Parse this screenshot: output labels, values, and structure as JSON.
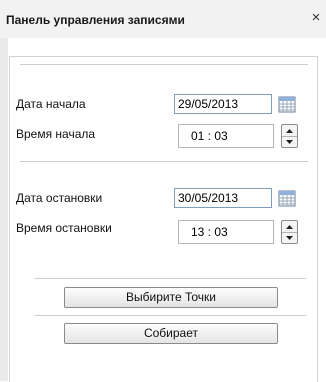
{
  "window": {
    "title": "Панель управления записями",
    "close_label": "×"
  },
  "form": {
    "start_date": {
      "label": "Дата начала",
      "value": "29/05/2013"
    },
    "start_time": {
      "label": "Время начала",
      "value": "01 : 03"
    },
    "stop_date": {
      "label": "Дата остановки",
      "value": "30/05/2013"
    },
    "stop_time": {
      "label": "Время остановки",
      "value": "13 : 03"
    }
  },
  "buttons": {
    "select_points": "Выбирите Точки",
    "collect": "Собирает"
  },
  "icons": {
    "calendar": "calendar-icon",
    "spin_up": "triangle-up-icon",
    "spin_down": "triangle-down-icon",
    "close": "close-icon"
  },
  "colors": {
    "titlebar_bg": "#f2f2f2",
    "input_border": "#7f9db9",
    "panel_border": "#d2d2d2"
  }
}
